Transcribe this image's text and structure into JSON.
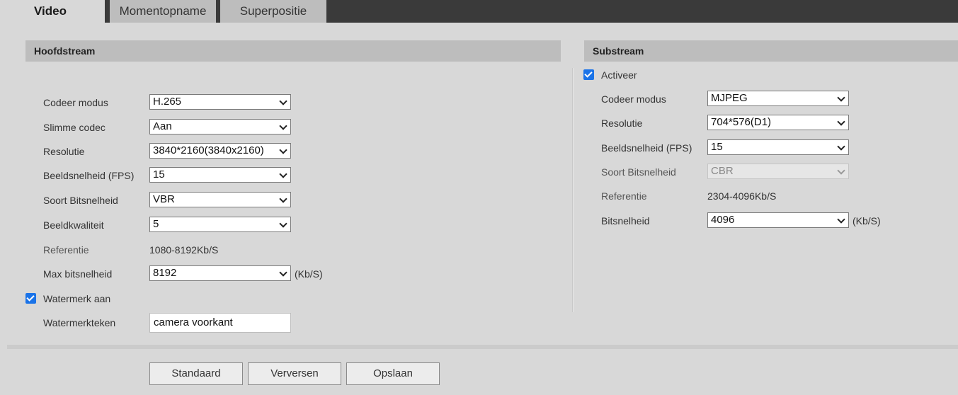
{
  "tabs": [
    {
      "label": "Video"
    },
    {
      "label": "Momentopname"
    },
    {
      "label": "Superpositie"
    }
  ],
  "main": {
    "title": "Hoofdstream",
    "codeer_modus": {
      "label": "Codeer modus",
      "value": "H.265"
    },
    "slimme_codec": {
      "label": "Slimme codec",
      "value": "Aan"
    },
    "resolutie": {
      "label": "Resolutie",
      "value": "3840*2160(3840x2160)"
    },
    "fps": {
      "label": "Beeldsnelheid (FPS)",
      "value": "15"
    },
    "soort_bitsnelheid": {
      "label": "Soort Bitsnelheid",
      "value": "VBR"
    },
    "beeldkwaliteit": {
      "label": "Beeldkwaliteit",
      "value": "5"
    },
    "referentie": {
      "label": "Referentie",
      "value": "1080-8192Kb/S"
    },
    "max_bitsnelheid": {
      "label": "Max bitsnelheid",
      "value": "8192",
      "unit": "(Kb/S)"
    },
    "watermerk": {
      "label": "Watermerk aan",
      "checked": true
    },
    "watermerkteken": {
      "label": "Watermerkteken",
      "value": "camera voorkant"
    }
  },
  "sub": {
    "title": "Substream",
    "activeer": {
      "label": "Activeer",
      "checked": true
    },
    "codeer_modus": {
      "label": "Codeer modus",
      "value": "MJPEG"
    },
    "resolutie": {
      "label": "Resolutie",
      "value": "704*576(D1)"
    },
    "fps": {
      "label": "Beeldsnelheid (FPS)",
      "value": "15"
    },
    "soort_bitsnelheid": {
      "label": "Soort Bitsnelheid",
      "value": "CBR"
    },
    "referentie": {
      "label": "Referentie",
      "value": "2304-4096Kb/S"
    },
    "bitsnelheid": {
      "label": "Bitsnelheid",
      "value": "4096",
      "unit": "(Kb/S)"
    }
  },
  "buttons": {
    "standaard": "Standaard",
    "verversen": "Verversen",
    "opslaan": "Opslaan"
  },
  "colors": {
    "accent": "#1a73e8",
    "tabbar": "#3a3a3a",
    "section": "#bdbdbd"
  }
}
